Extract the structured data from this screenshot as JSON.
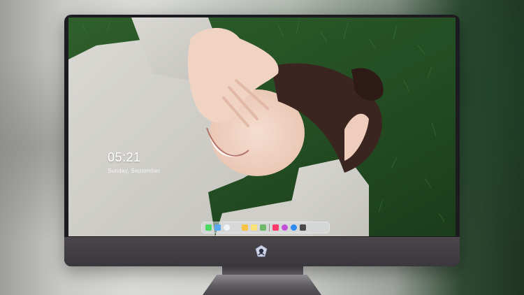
{
  "lock_screen": {
    "time": "05:21",
    "date": "Sunday, September"
  },
  "dock": {
    "icons": [
      {
        "name": "finder-icon",
        "color": "#4cd964"
      },
      {
        "name": "launchpad-icon",
        "color": "#5aa9f0"
      },
      {
        "name": "safari-icon",
        "color": "#f0f4f8"
      },
      {
        "name": "mail-icon",
        "color": "#d7d7d7"
      },
      {
        "name": "photos-icon",
        "color": "#f6c343"
      },
      {
        "name": "notes-icon",
        "color": "#f8e27a"
      },
      {
        "name": "preview-icon",
        "color": "#6fb86a"
      },
      {
        "name": "music-icon",
        "color": "#ff3b6b"
      },
      {
        "name": "itunes-icon",
        "color": "#c450d9"
      },
      {
        "name": "app-store-icon",
        "color": "#2f8cf0"
      },
      {
        "name": "camera-icon",
        "color": "#4a4a4a"
      }
    ]
  },
  "colors": {
    "bezel": "#1c1b1f",
    "chin": "#423f45",
    "grass": "#2c5a2a"
  }
}
